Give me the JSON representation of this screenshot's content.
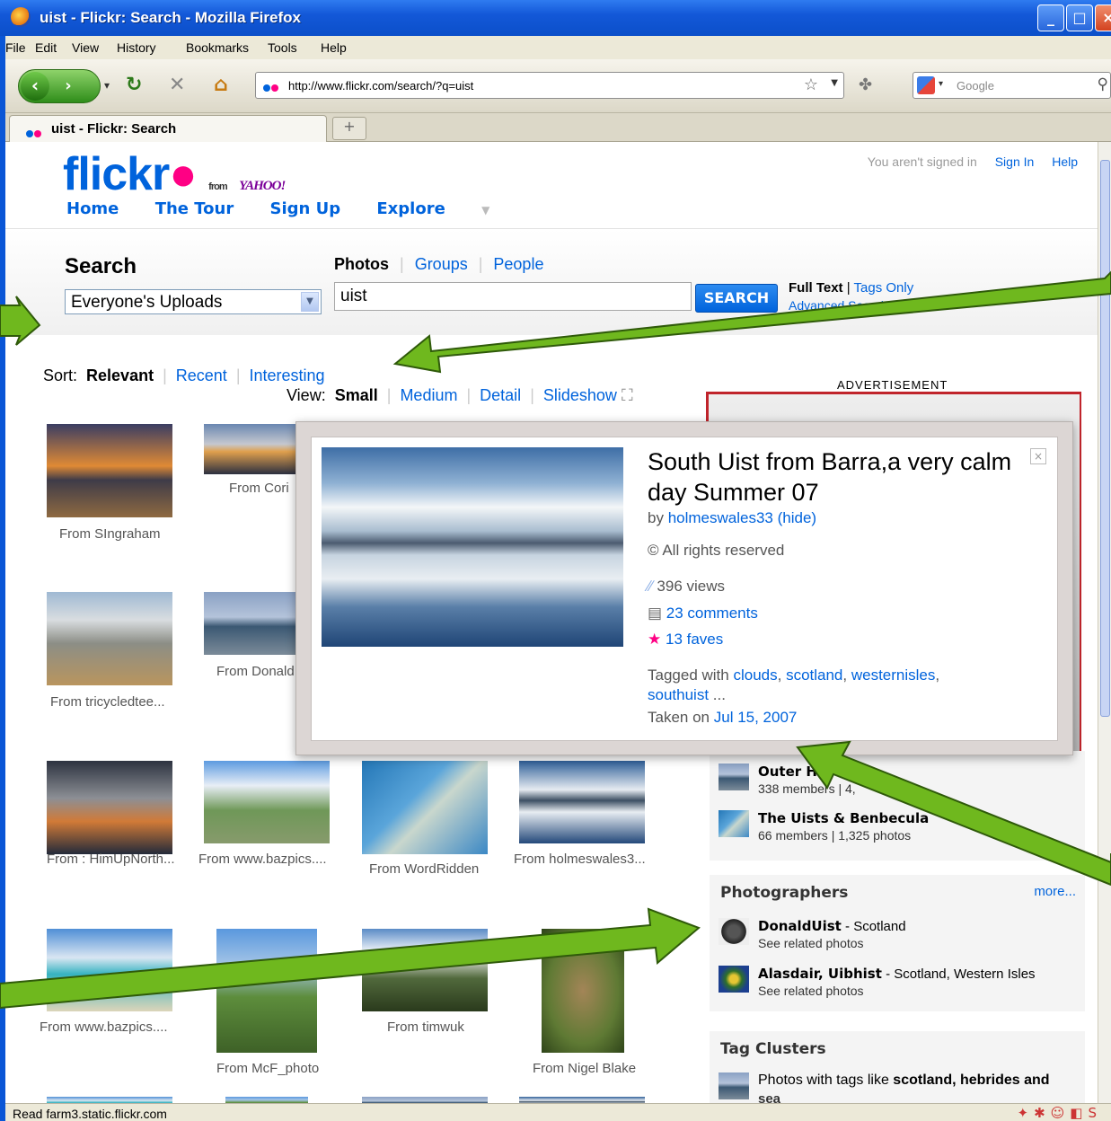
{
  "window": {
    "title": "uist - Flickr: Search - Mozilla Firefox"
  },
  "menu": [
    "File",
    "Edit",
    "View",
    "History",
    "Bookmarks",
    "Tools",
    "Help"
  ],
  "nav": {
    "url": "http://www.flickr.com/search/?q=uist",
    "search_placeholder": "Google"
  },
  "tab": {
    "label": "uist - Flickr: Search"
  },
  "status": {
    "text": "Read farm3.static.flickr.com"
  },
  "flickr": {
    "logo": {
      "text": "flickr",
      "from": "from",
      "yahoo": "YAHOO!"
    },
    "account": {
      "notice": "You aren't signed in",
      "sign_in": "Sign In",
      "help": "Help"
    },
    "main_nav": [
      "Home",
      "The Tour",
      "Sign Up",
      "Explore"
    ],
    "search": {
      "title": "Search",
      "scope": "Everyone's Uploads",
      "types": {
        "active": "Photos",
        "groups": "Groups",
        "people": "People"
      },
      "query": "uist",
      "button": "SEARCH",
      "full_text": "Full Text",
      "tags_only": "Tags Only",
      "advanced": "Advanced Search"
    },
    "sort": {
      "label": "Sort:",
      "active": "Relevant",
      "recent": "Recent",
      "interesting": "Interesting"
    },
    "view": {
      "label": "View:",
      "active": "Small",
      "medium": "Medium",
      "detail": "Detail",
      "slideshow": "Slideshow"
    },
    "advertisement": "ADVERTISEMENT",
    "results": [
      {
        "caption": "From SIngraham"
      },
      {
        "caption": "From Cori"
      },
      {
        "caption": "From tricycledtee..."
      },
      {
        "caption": "From Donald"
      },
      {
        "caption": "From : HimUpNorth..."
      },
      {
        "caption": "From www.bazpics...."
      },
      {
        "caption": "From WordRidden"
      },
      {
        "caption": "From holmeswales3..."
      },
      {
        "caption": "From www.bazpics...."
      },
      {
        "caption": "From McF_photo"
      },
      {
        "caption": "From timwuk"
      },
      {
        "caption": "From Nigel Blake"
      }
    ],
    "groups": [
      {
        "name": "Outer H",
        "stats": "338 members | 4,"
      },
      {
        "name": "The Uists & Benbecula",
        "stats": "66 members | 1,325 photos"
      }
    ],
    "photographers": {
      "title": "Photographers",
      "more": "more...",
      "items": [
        {
          "name": "DonaldUist",
          "location": " - Scotland",
          "related": "See related photos"
        },
        {
          "name": "Alasdair, Uibhist",
          "location": " - Scotland, Western Isles",
          "related": "See related photos"
        }
      ]
    },
    "tag_clusters": {
      "title": "Tag Clusters",
      "prefix": "Photos with tags like ",
      "tags": "scotland, hebrides and",
      "cont": "sea"
    }
  },
  "popup": {
    "title": "South Uist from Barra,a very calm day Summer 07",
    "by": "by",
    "author": "holmeswales33",
    "hide": "(hide)",
    "rights": "All rights reserved",
    "views": "396 views",
    "comments": "23 comments",
    "faves": "13 faves",
    "tagged_prefix": "Tagged with",
    "tags": [
      "clouds",
      "scotland",
      "westernisles",
      "southuist"
    ],
    "taken_prefix": "Taken on",
    "taken_date": "Jul 15, 2007"
  },
  "colors": {
    "accent": "#0063dc",
    "pink": "#ff0084",
    "arrow": "#6fb81e"
  }
}
